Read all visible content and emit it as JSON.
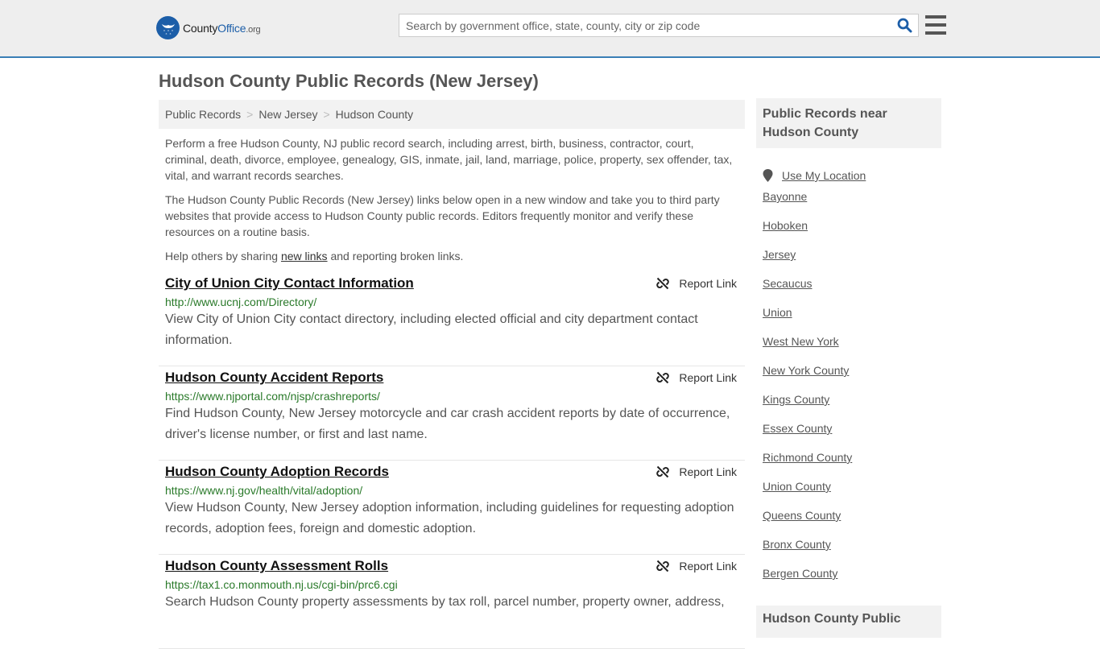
{
  "header": {
    "logo": {
      "prefix": "County",
      "brand": "Office",
      "tld": ".org"
    },
    "search_placeholder": "Search by government office, state, county, city or zip code"
  },
  "page_title": "Hudson County Public Records (New Jersey)",
  "breadcrumb": [
    "Public Records",
    "New Jersey",
    "Hudson County"
  ],
  "intro": {
    "p1": "Perform a free Hudson County, NJ public record search, including arrest, birth, business, contractor, court, criminal, death, divorce, employee, genealogy, GIS, inmate, jail, land, marriage, police, property, sex offender, tax, vital, and warrant records searches.",
    "p2": "The Hudson County Public Records (New Jersey) links below open in a new window and take you to third party websites that provide access to Hudson County public records. Editors frequently monitor and verify these resources on a routine basis.",
    "p3_before": "Help others by sharing ",
    "p3_link": "new links",
    "p3_after": " and reporting broken links."
  },
  "report_label": "Report Link",
  "entries": [
    {
      "title": "City of Union City Contact Information",
      "url": "http://www.ucnj.com/Directory/",
      "desc": "View City of Union City contact directory, including elected official and city department contact information."
    },
    {
      "title": "Hudson County Accident Reports",
      "url": "https://www.njportal.com/njsp/crashreports/",
      "desc": "Find Hudson County, New Jersey motorcycle and car crash accident reports by date of occurrence, driver's license number, or first and last name."
    },
    {
      "title": "Hudson County Adoption Records",
      "url": "https://www.nj.gov/health/vital/adoption/",
      "desc": "View Hudson County, New Jersey adoption information, including guidelines for requesting adoption records, adoption fees, foreign and domestic adoption."
    },
    {
      "title": "Hudson County Assessment Rolls",
      "url": "https://tax1.co.monmouth.nj.us/cgi-bin/prc6.cgi",
      "desc": "Search Hudson County property assessments by tax roll, parcel number, property owner, address,"
    }
  ],
  "sidebar": {
    "heading": "Public Records near Hudson County",
    "use_location": "Use My Location",
    "links": [
      "Bayonne",
      "Hoboken",
      "Jersey",
      "Secaucus",
      "Union",
      "West New York",
      "New York County",
      "Kings County",
      "Essex County",
      "Richmond County",
      "Union County",
      "Queens County",
      "Bronx County",
      "Bergen County"
    ],
    "heading2": "Hudson County Public"
  },
  "colors": {
    "brand": "#1c5ea8",
    "header_border": "#3a7fb5",
    "url_green": "#2a7a2a"
  }
}
